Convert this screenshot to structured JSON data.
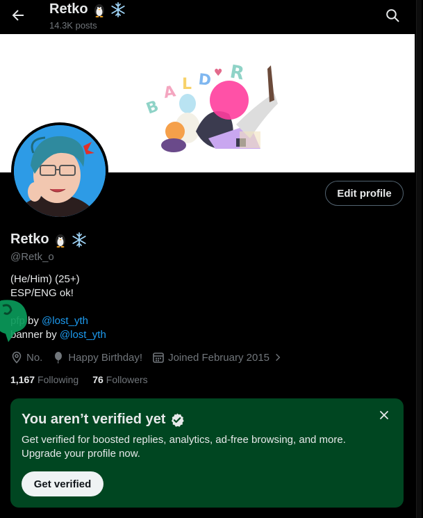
{
  "header": {
    "title": "Retko",
    "posts": "14.3K posts"
  },
  "profile": {
    "name": "Retko",
    "handle": "@Retk_o",
    "edit_button": "Edit profile",
    "bio": {
      "line1": "(He/Him) (25+)",
      "line2": "ESP/ENG ok!",
      "pfp_prefix": "pfp by ",
      "pfp_link": "@lost_yth",
      "banner_prefix": "banner by ",
      "banner_link": "@lost_yth"
    },
    "location": "No.",
    "birthday": "Happy Birthday!",
    "joined": "Joined February 2015",
    "following_count": "1,167",
    "following_label": "Following",
    "followers_count": "76",
    "followers_label": "Followers"
  },
  "verify": {
    "title": "You aren’t verified yet",
    "description": "Get verified for boosted replies, analytics, ad-free browsing, and more. Upgrade your profile now.",
    "button": "Get verified"
  },
  "colors": {
    "background": "#000000",
    "text": "#e7e9ea",
    "muted": "#71767b",
    "link": "#1d9bf0",
    "verify_card": "#004621"
  },
  "icons": [
    "back-arrow-icon",
    "search-icon",
    "penguin-icon",
    "snowflake-icon",
    "location-icon",
    "balloon-icon",
    "calendar-icon",
    "chevron-right-icon",
    "verified-badge-icon",
    "close-icon"
  ]
}
